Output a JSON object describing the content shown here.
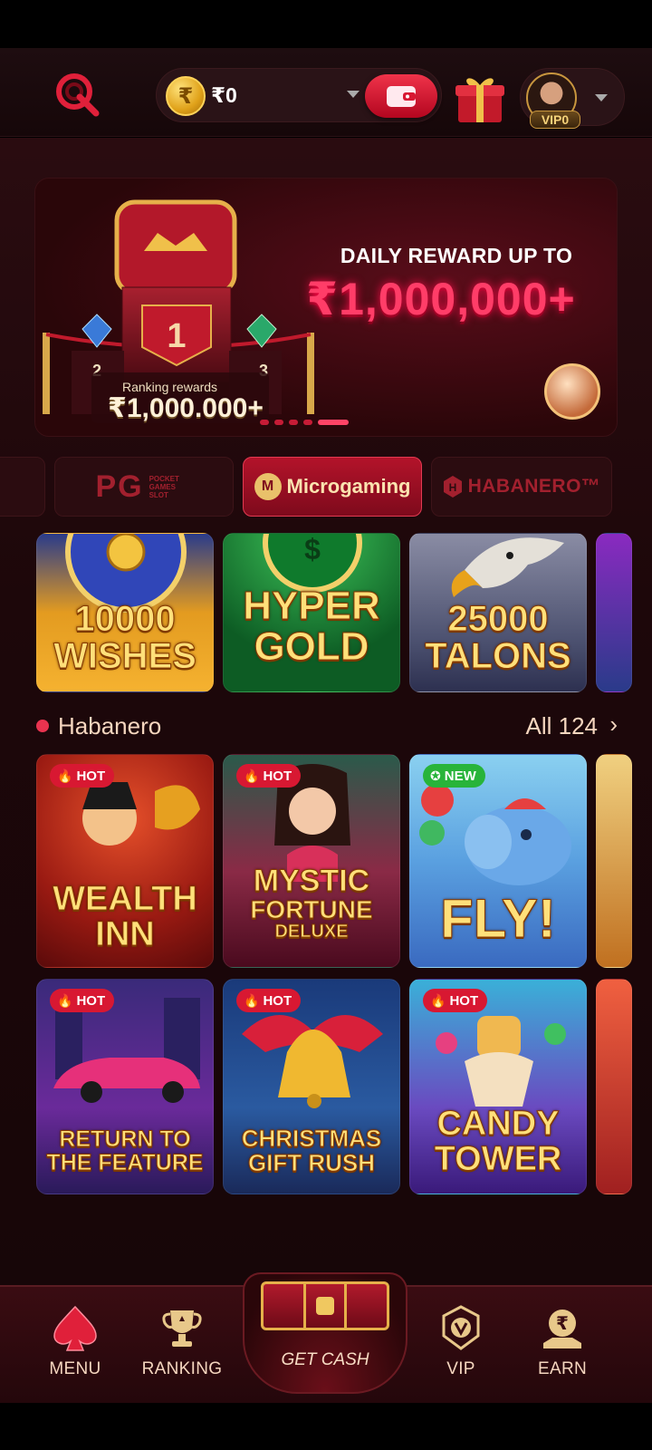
{
  "header": {
    "balance": "₹0",
    "coin_symbol": "₹",
    "vip_level": "VIP0"
  },
  "banner": {
    "title": "DAILY REWARD UP TO",
    "amount": "₹1,000,000+",
    "ranking_label": "Ranking rewards",
    "ranking_amount": "₹1,000.000+",
    "podium_ranks": [
      "1",
      "2",
      "3"
    ]
  },
  "providers": {
    "items": [
      {
        "label": "PG",
        "sublabel": "POCKET GAMES SLOT"
      },
      {
        "label": "Microgaming"
      },
      {
        "label": "HABANERO™"
      }
    ]
  },
  "microgaming_games": [
    {
      "title_line1": "10000",
      "title_line2": "WISHES"
    },
    {
      "title_line1": "HYPER",
      "title_line2": "GOLD"
    },
    {
      "title_line1": "25000",
      "title_line2": "TALONS"
    }
  ],
  "section": {
    "title": "Habanero",
    "all_label": "All 124",
    "chevron": "›"
  },
  "habanero_games": [
    {
      "tag": "HOT",
      "title_line1": "WEALTH",
      "title_line2": "INN"
    },
    {
      "tag": "HOT",
      "title_line1": "MYSTIC",
      "title_line2": "FORTUNE",
      "title_line3": "DELUXE"
    },
    {
      "tag": "NEW",
      "title_line1": "FLY!"
    },
    {
      "tag": "HOT",
      "title_line1": "RETURN TO",
      "title_line2": "THE FEATURE"
    },
    {
      "tag": "HOT",
      "title_line1": "CHRISTMAS",
      "title_line2": "GIFT RUSH"
    },
    {
      "tag": "HOT",
      "title_line1": "CANDY",
      "title_line2": "TOWER"
    }
  ],
  "bottom_nav": {
    "menu": "MENU",
    "ranking": "RANKING",
    "get_cash": "GET CASH",
    "vip": "VIP",
    "earn": "EARN"
  },
  "colors": {
    "accent": "#e8334f",
    "background": "#1d070a",
    "gold": "#ffe07a"
  }
}
